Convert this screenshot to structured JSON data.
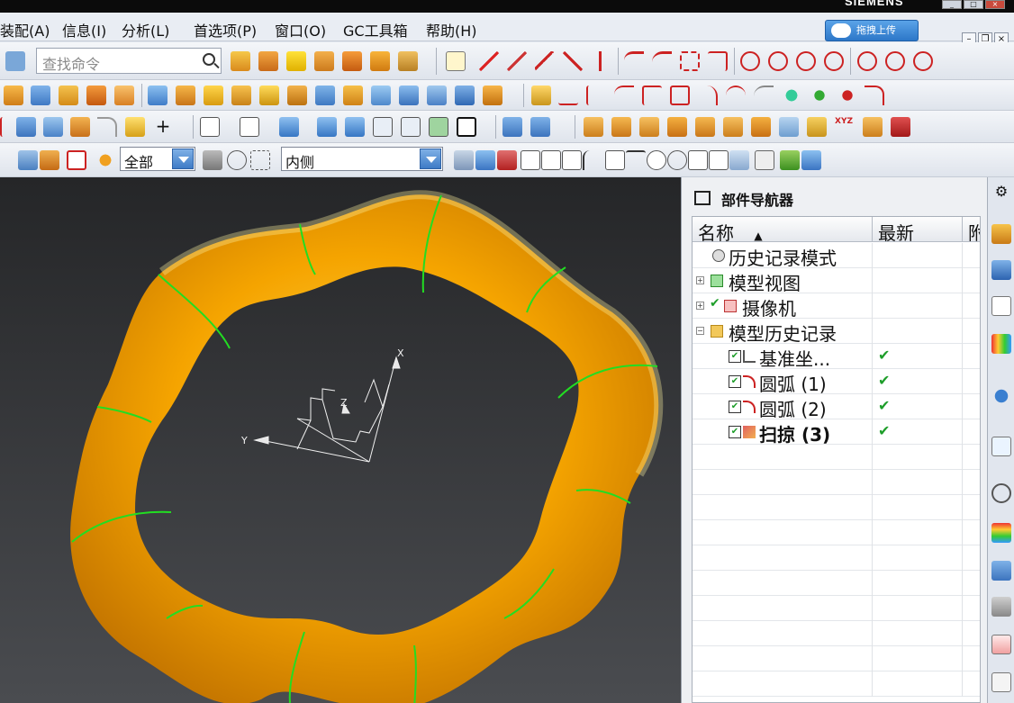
{
  "brand": "SIEMENS",
  "upload_button": "拖拽上传",
  "menu": [
    "装配(A)",
    "信息(I)",
    "分析(L)",
    "首选项(P)",
    "窗口(O)",
    "GC工具箱",
    "帮助(H)"
  ],
  "search": {
    "placeholder": "查找命令"
  },
  "filters": {
    "type_filter": "全部",
    "scope_filter": "内侧"
  },
  "navigator": {
    "title": "部件导航器",
    "columns": {
      "name": "名称",
      "latest": "最新",
      "third": "附"
    },
    "items": [
      {
        "label": "历史记录模式",
        "icon": "clock-icon",
        "latest": ""
      },
      {
        "label": "模型视图",
        "icon": "model-view-icon",
        "latest": ""
      },
      {
        "label": "摄像机",
        "icon": "camera-icon",
        "latest": ""
      },
      {
        "label": "模型历史记录",
        "icon": "folder-icon",
        "latest": ""
      },
      {
        "label": "基准坐...",
        "icon": "datum-csys-icon",
        "latest": "✔"
      },
      {
        "label": "圆弧 (1)",
        "icon": "arc-icon",
        "latest": "✔"
      },
      {
        "label": "圆弧 (2)",
        "icon": "arc-icon",
        "latest": "✔"
      },
      {
        "label": "扫掠 (3)",
        "icon": "sweep-icon",
        "latest": "✔"
      }
    ]
  },
  "viewport": {
    "axis_labels": {
      "x": "X",
      "y": "Y",
      "z": "Z"
    },
    "model_color": "#f5a400",
    "edge_color": "#22dd22",
    "background_top": "#252628",
    "background_bottom": "#4a4c50"
  },
  "colors": {
    "accent": "#2d77c8",
    "check": "#1e9e2a"
  }
}
